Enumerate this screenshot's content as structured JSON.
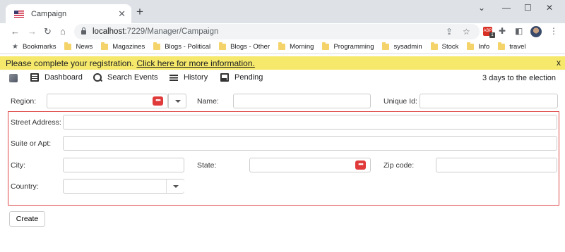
{
  "browser": {
    "tab_title": "Campaign",
    "url_host": "localhost",
    "url_path": ":7229/Manager/Campaign",
    "bookmarks": [
      "Bookmarks",
      "News",
      "Magazines",
      "Blogs - Political",
      "Blogs - Other",
      "Morning",
      "Programming",
      "sysadmin",
      "Stock",
      "Info",
      "travel"
    ]
  },
  "banner": {
    "text": "Please complete your registration.",
    "link": "Click here for more information.",
    "close": "x"
  },
  "menu": {
    "items": [
      "Dashboard",
      "Search Events",
      "History",
      "Pending"
    ],
    "election_notice": "3 days to the election"
  },
  "form": {
    "region_label": "Region:",
    "name_label": "Name:",
    "unique_id_label": "Unique Id:",
    "street_label": "Street Address:",
    "suite_label": "Suite or Apt:",
    "city_label": "City:",
    "state_label": "State:",
    "zip_label": "Zip code:",
    "country_label": "Country:",
    "dots": "•••",
    "create_label": "Create"
  }
}
